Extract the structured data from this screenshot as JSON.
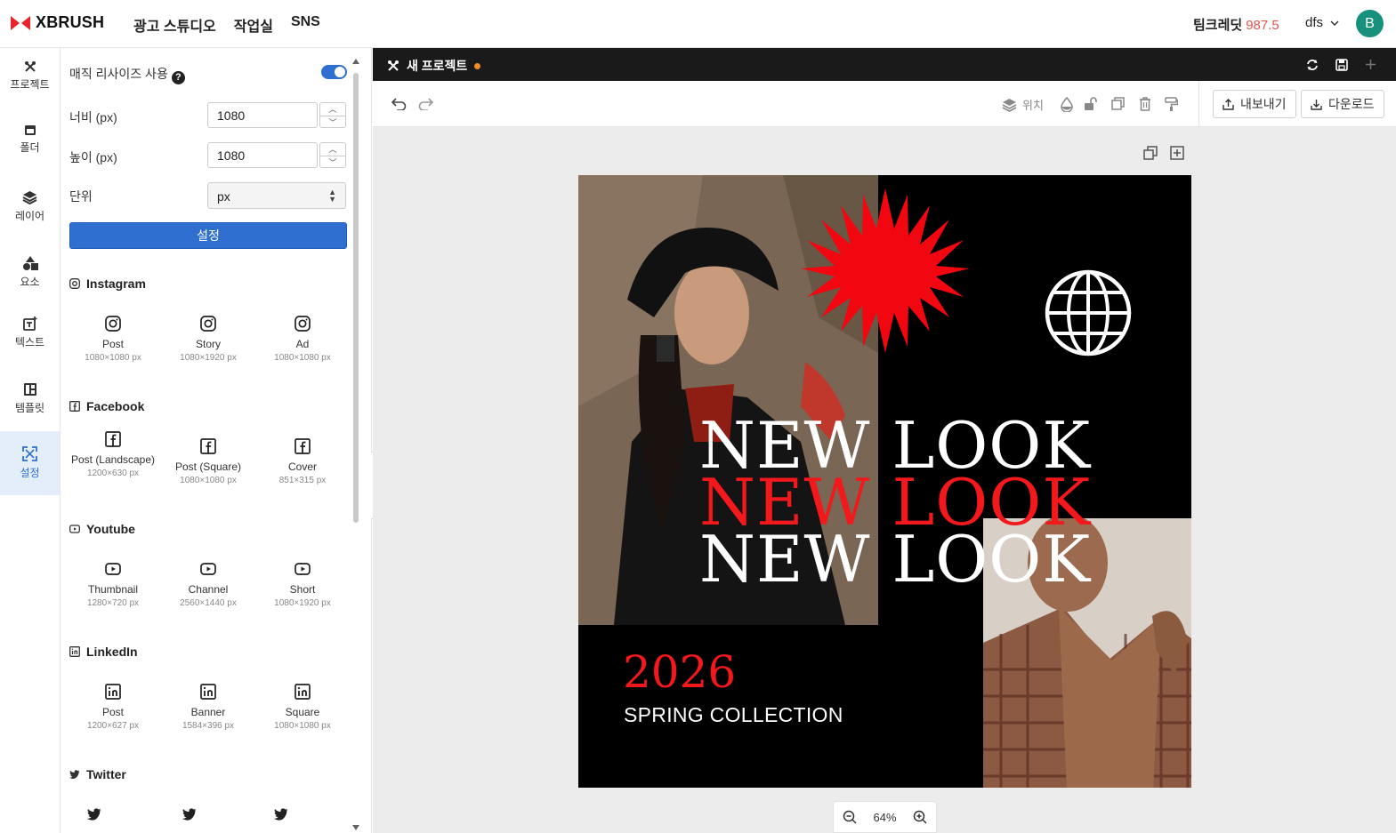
{
  "header": {
    "logo_text": "XBRUSH",
    "nav": [
      "광고 스튜디오",
      "작업실",
      "SNS"
    ],
    "credit_label": "팀크레딧",
    "credit_value": "987.5",
    "username": "dfs",
    "avatar_letter": "B"
  },
  "rail": {
    "items": [
      {
        "label": "프로젝트",
        "icon": "project-icon"
      },
      {
        "label": "폴더",
        "icon": "folder-icon"
      },
      {
        "label": "레이어",
        "icon": "layers-icon"
      },
      {
        "label": "요소",
        "icon": "shapes-icon"
      },
      {
        "label": "텍스트",
        "icon": "text-icon"
      },
      {
        "label": "템플릿",
        "icon": "template-icon"
      },
      {
        "label": "설정",
        "icon": "resize-icon",
        "active": true
      }
    ]
  },
  "panel": {
    "magic_resize_label": "매직 리사이즈 사용",
    "magic_resize_on": true,
    "width_label": "너비 (px)",
    "width_value": "1080",
    "height_label": "높이 (px)",
    "height_value": "1080",
    "unit_label": "단위",
    "unit_value": "px",
    "set_button": "설정",
    "sections": [
      {
        "title": "Instagram",
        "presets": [
          {
            "name": "Post",
            "size": "1080×1080 px"
          },
          {
            "name": "Story",
            "size": "1080×1920 px"
          },
          {
            "name": "Ad",
            "size": "1080×1080 px"
          }
        ]
      },
      {
        "title": "Facebook",
        "presets": [
          {
            "name": "Post (Landscape)",
            "size": "1200×630 px"
          },
          {
            "name": "Post (Square)",
            "size": "1080×1080 px"
          },
          {
            "name": "Cover",
            "size": "851×315 px"
          }
        ]
      },
      {
        "title": "Youtube",
        "presets": [
          {
            "name": "Thumbnail",
            "size": "1280×720 px"
          },
          {
            "name": "Channel",
            "size": "2560×1440 px"
          },
          {
            "name": "Short",
            "size": "1080×1920 px"
          }
        ]
      },
      {
        "title": "LinkedIn",
        "presets": [
          {
            "name": "Post",
            "size": "1200×627 px"
          },
          {
            "name": "Banner",
            "size": "1584×396 px"
          },
          {
            "name": "Square",
            "size": "1080×1080 px"
          }
        ]
      },
      {
        "title": "Twitter",
        "presets": []
      }
    ]
  },
  "editor": {
    "tab_title": "새 프로젝트",
    "position_label": "위치",
    "export_button": "내보내기",
    "download_button": "다운로드",
    "zoom": "64%"
  },
  "artwork": {
    "headline": "NEW LOOK",
    "year": "2026",
    "subline": "SPRING COLLECTION",
    "accent_red": "#f2181b"
  }
}
